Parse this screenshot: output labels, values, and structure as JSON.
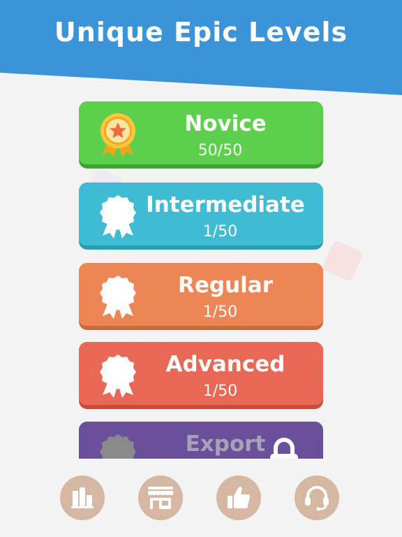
{
  "header": {
    "title": "Unique Epic Levels"
  },
  "colors": {
    "header_bg": "#3c94d8",
    "novice": "#5ccf4d",
    "intermediate": "#3fbcd4",
    "regular": "#ec8755",
    "advanced": "#e96855",
    "expert": "#6a4f9b",
    "nav_button": "#d6b7a4"
  },
  "levels": [
    {
      "name": "Novice",
      "progress": "50/50",
      "badge": "gold-ribbon-medal-icon",
      "locked": false
    },
    {
      "name": "Intermediate",
      "progress": "1/50",
      "badge": "ribbon-badge-icon",
      "locked": false
    },
    {
      "name": "Regular",
      "progress": "1/50",
      "badge": "ribbon-badge-icon",
      "locked": false
    },
    {
      "name": "Advanced",
      "progress": "1/50",
      "badge": "ribbon-badge-icon",
      "locked": false
    },
    {
      "name": "Export",
      "progress": "",
      "badge": "ribbon-badge-icon",
      "locked": true
    }
  ],
  "bottom_nav": [
    {
      "icon": "bar-chart-icon",
      "label": ""
    },
    {
      "icon": "shop-icon",
      "label": ""
    },
    {
      "icon": "thumbs-up-icon",
      "label": ""
    },
    {
      "icon": "headset-icon",
      "label": ""
    }
  ]
}
